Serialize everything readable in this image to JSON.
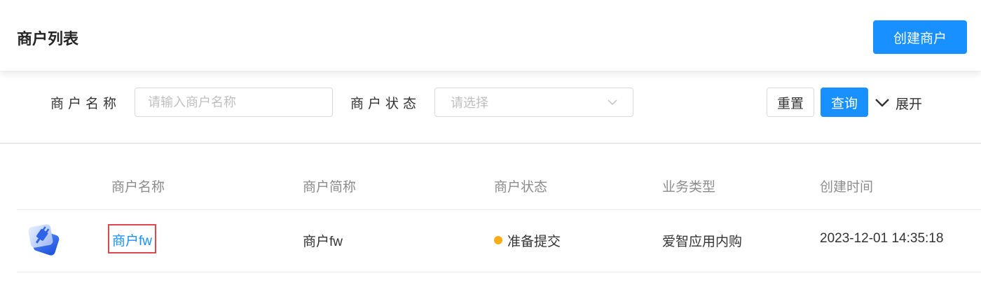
{
  "header": {
    "title": "商户列表",
    "create_button": "创建商户"
  },
  "filters": {
    "name_label": "商户名称",
    "name_placeholder": "请输入商户名称",
    "status_label": "商户状态",
    "status_placeholder": "请选择",
    "reset_label": "重置",
    "query_label": "查询",
    "expand_label": "展开"
  },
  "table": {
    "columns": [
      "商户名称",
      "商户简称",
      "商户状态",
      "业务类型",
      "创建时间"
    ],
    "rows": [
      {
        "icon": "plugin-app-icon",
        "name": "商户fw",
        "short_name": "商户fw",
        "status": "准备提交",
        "business_type": "爱智应用内购",
        "created_at": "2023-12-01 14:35:18"
      }
    ]
  },
  "colors": {
    "primary": "#1890ff",
    "status_pending": "#faad14",
    "highlight_border": "#e0474c"
  }
}
